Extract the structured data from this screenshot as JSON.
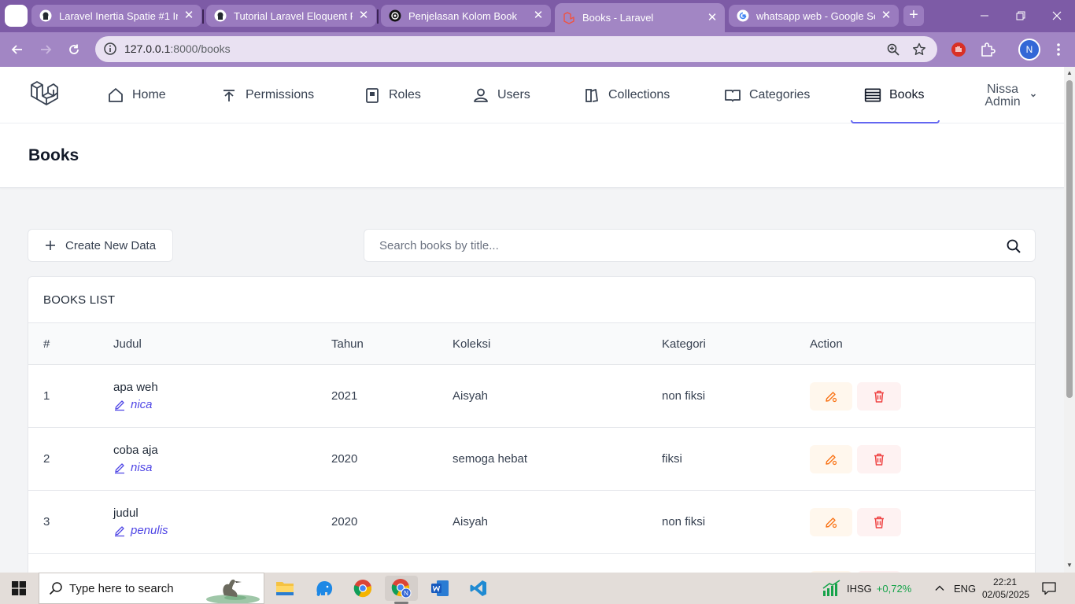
{
  "browser": {
    "tabs": [
      {
        "title": "Laravel Inertia Spatie #1 Inst",
        "icon": "github-icon"
      },
      {
        "title": "Tutorial Laravel Eloquent Rel",
        "icon": "github-icon"
      },
      {
        "title": "Penjelasan Kolom Book",
        "icon": "chatgpt-icon"
      },
      {
        "title": "Books - Laravel",
        "icon": "laravel-icon",
        "active": true
      },
      {
        "title": "whatsapp web - Google Sea",
        "icon": "google-icon"
      }
    ],
    "url_host": "127.0.0.1",
    "url_rest": ":8000/books",
    "profile_initial": "N"
  },
  "nav": {
    "items": [
      {
        "label": "Home",
        "icon": "home-icon"
      },
      {
        "label": "Permissions",
        "icon": "permissions-icon"
      },
      {
        "label": "Roles",
        "icon": "roles-icon"
      },
      {
        "label": "Users",
        "icon": "user-icon"
      },
      {
        "label": "Collections",
        "icon": "collections-icon"
      },
      {
        "label": "Categories",
        "icon": "categories-icon"
      },
      {
        "label": "Books",
        "icon": "books-icon",
        "active": true
      }
    ],
    "user_first": "Nissa",
    "user_second": "Admin"
  },
  "page": {
    "title": "Books",
    "create_label": "Create New Data",
    "search_placeholder": "Search books by title..."
  },
  "table": {
    "title": "BOOKS LIST",
    "columns": [
      "#",
      "Judul",
      "Tahun",
      "Koleksi",
      "Kategori",
      "Action"
    ],
    "rows": [
      {
        "no": "1",
        "judul": "apa weh",
        "penulis": "nica",
        "tahun": "2021",
        "koleksi": "Aisyah",
        "kategori": "non fiksi"
      },
      {
        "no": "2",
        "judul": "coba aja",
        "penulis": "nisa",
        "tahun": "2020",
        "koleksi": "semoga hebat",
        "kategori": "fiksi"
      },
      {
        "no": "3",
        "judul": "judul",
        "penulis": "penulis",
        "tahun": "2020",
        "koleksi": "Aisyah",
        "kategori": "non fiksi"
      }
    ]
  },
  "taskbar": {
    "search_placeholder": "Type here to search",
    "stock_name": "IHSG",
    "stock_change": "+0,72%",
    "language": "ENG",
    "time": "22:21",
    "date": "02/05/2025"
  },
  "colors": {
    "browser_frame": "#7d5ba6",
    "accent": "#6366f1",
    "author_link": "#4f46e5",
    "edit_bg": "#fff7ed",
    "delete_bg": "#fef2f2",
    "edit_icon": "#f97316",
    "delete_icon": "#ef4444",
    "stock_up": "#16a34a"
  }
}
